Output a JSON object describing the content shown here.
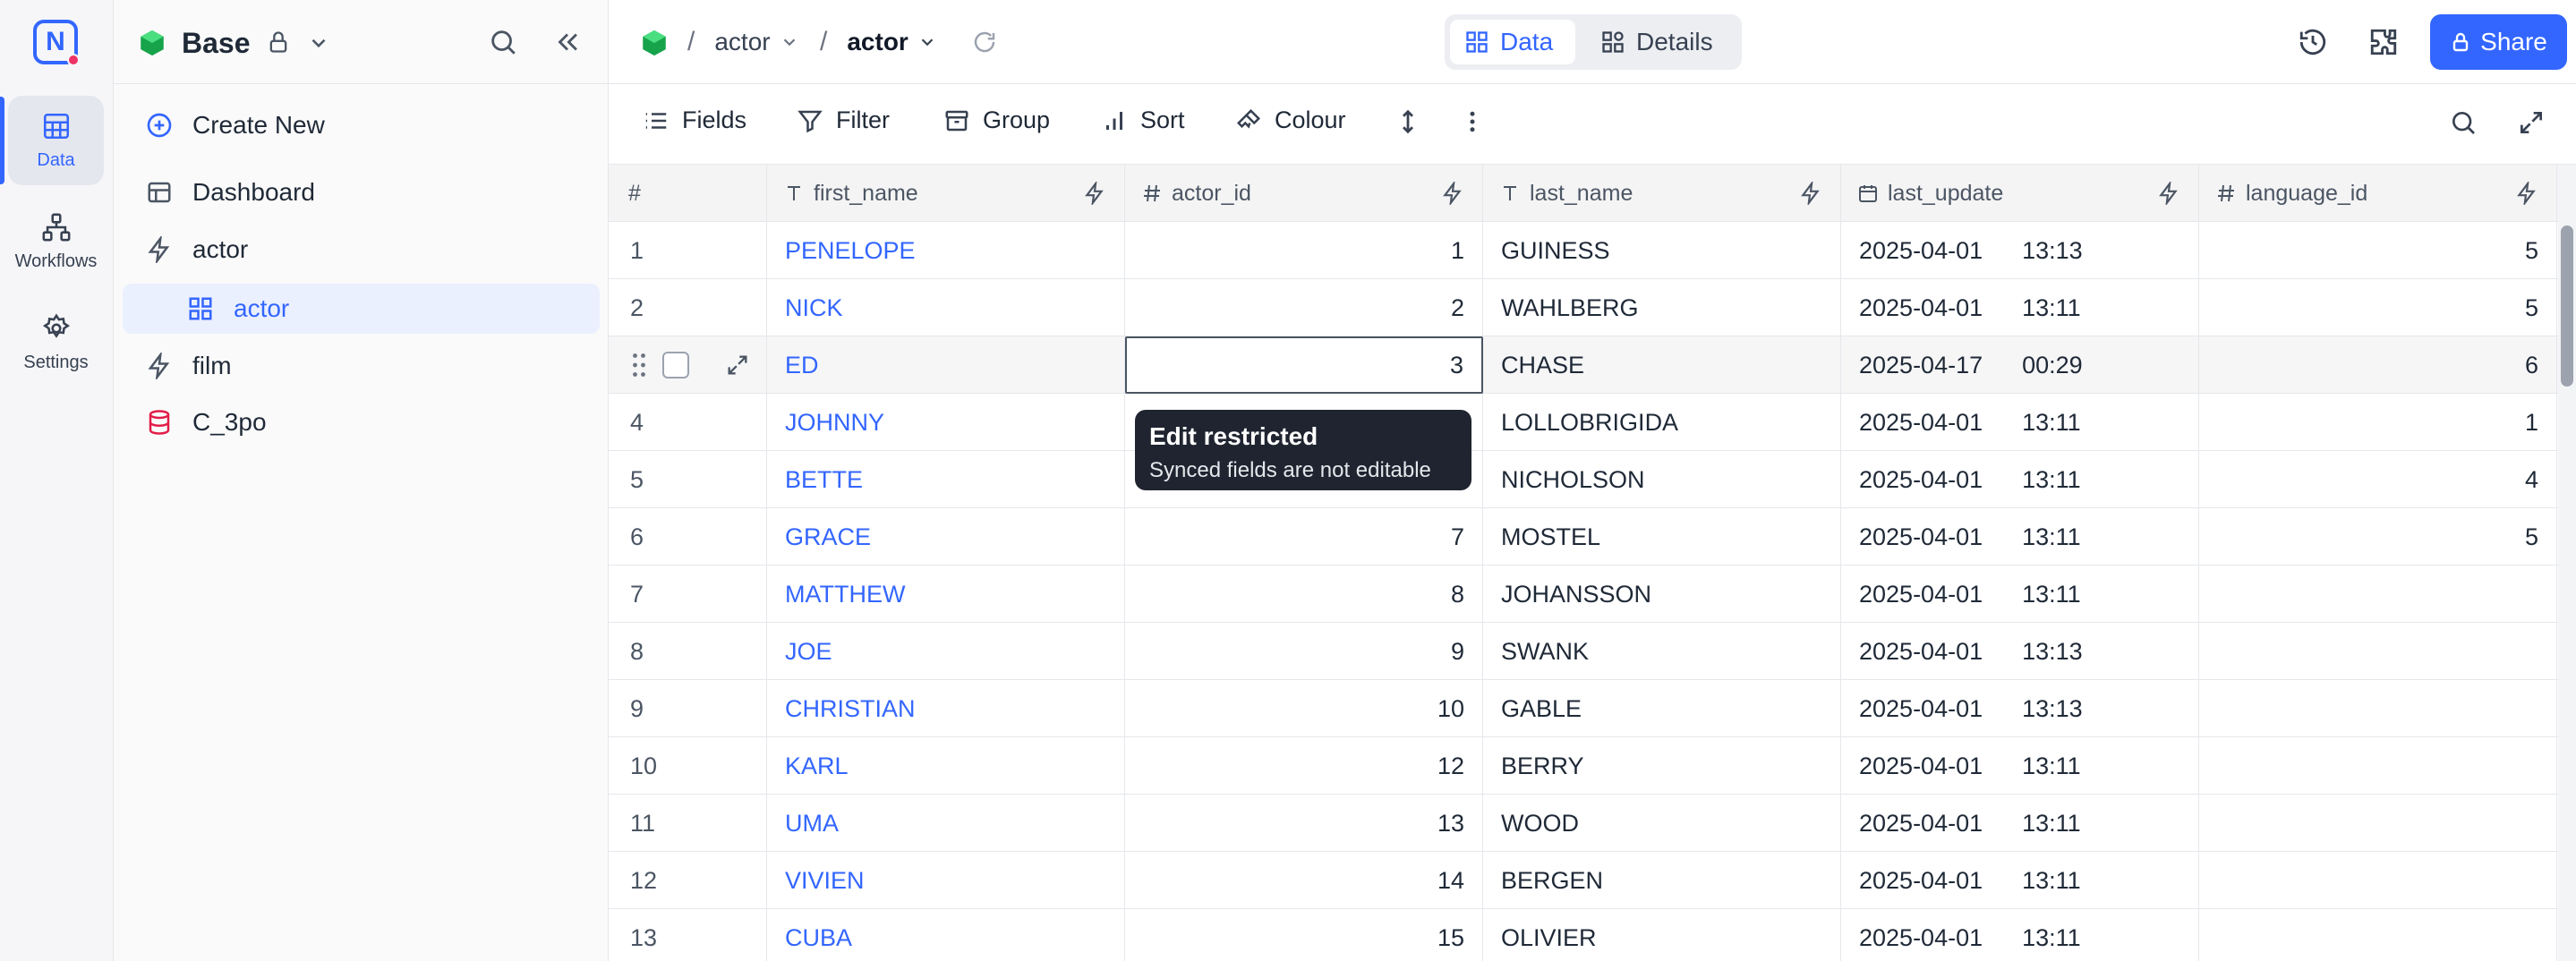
{
  "rail": {
    "items": [
      {
        "label": "Data"
      },
      {
        "label": "Workflows"
      },
      {
        "label": "Settings"
      }
    ]
  },
  "colors": {
    "accent": "#3366ff",
    "base_icon": "#22c55e",
    "source_icon": "#e11d48"
  },
  "sidebar": {
    "base_title": "Base",
    "create_new": "Create New",
    "items": [
      {
        "label": "Dashboard"
      },
      {
        "label": "actor"
      },
      {
        "label": "actor"
      },
      {
        "label": "film"
      },
      {
        "label": "C_3po"
      }
    ]
  },
  "topbar": {
    "crumb_table": "actor",
    "crumb_view": "actor",
    "tab_data": "Data",
    "tab_details": "Details",
    "share": "Share"
  },
  "toolbar": {
    "fields": "Fields",
    "filter": "Filter",
    "group": "Group",
    "sort": "Sort",
    "colour": "Colour"
  },
  "grid": {
    "columns": [
      "#",
      "first_name",
      "actor_id",
      "last_name",
      "last_update",
      "language_id"
    ],
    "rows": [
      {
        "idx": "1",
        "first_name": "PENELOPE",
        "actor_id": "1",
        "last_name": "GUINESS",
        "date": "2025-04-01",
        "time": "13:13",
        "language_id": "5"
      },
      {
        "idx": "2",
        "first_name": "NICK",
        "actor_id": "2",
        "last_name": "WAHLBERG",
        "date": "2025-04-01",
        "time": "13:11",
        "language_id": "5"
      },
      {
        "idx": "",
        "first_name": "ED",
        "actor_id": "3",
        "last_name": "CHASE",
        "date": "2025-04-17",
        "time": "00:29",
        "language_id": "6"
      },
      {
        "idx": "4",
        "first_name": "JOHNNY",
        "actor_id": "",
        "last_name": "LOLLOBRIGIDA",
        "date": "2025-04-01",
        "time": "13:11",
        "language_id": "1"
      },
      {
        "idx": "5",
        "first_name": "BETTE",
        "actor_id": "",
        "last_name": "NICHOLSON",
        "date": "2025-04-01",
        "time": "13:11",
        "language_id": "4"
      },
      {
        "idx": "6",
        "first_name": "GRACE",
        "actor_id": "7",
        "last_name": "MOSTEL",
        "date": "2025-04-01",
        "time": "13:11",
        "language_id": "5"
      },
      {
        "idx": "7",
        "first_name": "MATTHEW",
        "actor_id": "8",
        "last_name": "JOHANSSON",
        "date": "2025-04-01",
        "time": "13:11",
        "language_id": ""
      },
      {
        "idx": "8",
        "first_name": "JOE",
        "actor_id": "9",
        "last_name": "SWANK",
        "date": "2025-04-01",
        "time": "13:13",
        "language_id": ""
      },
      {
        "idx": "9",
        "first_name": "CHRISTIAN",
        "actor_id": "10",
        "last_name": "GABLE",
        "date": "2025-04-01",
        "time": "13:13",
        "language_id": ""
      },
      {
        "idx": "10",
        "first_name": "KARL",
        "actor_id": "12",
        "last_name": "BERRY",
        "date": "2025-04-01",
        "time": "13:11",
        "language_id": ""
      },
      {
        "idx": "11",
        "first_name": "UMA",
        "actor_id": "13",
        "last_name": "WOOD",
        "date": "2025-04-01",
        "time": "13:11",
        "language_id": ""
      },
      {
        "idx": "12",
        "first_name": "VIVIEN",
        "actor_id": "14",
        "last_name": "BERGEN",
        "date": "2025-04-01",
        "time": "13:11",
        "language_id": ""
      },
      {
        "idx": "13",
        "first_name": "CUBA",
        "actor_id": "15",
        "last_name": "OLIVIER",
        "date": "2025-04-01",
        "time": "13:11",
        "language_id": ""
      }
    ]
  },
  "tooltip": {
    "title": "Edit restricted",
    "body": "Synced fields are not editable"
  }
}
